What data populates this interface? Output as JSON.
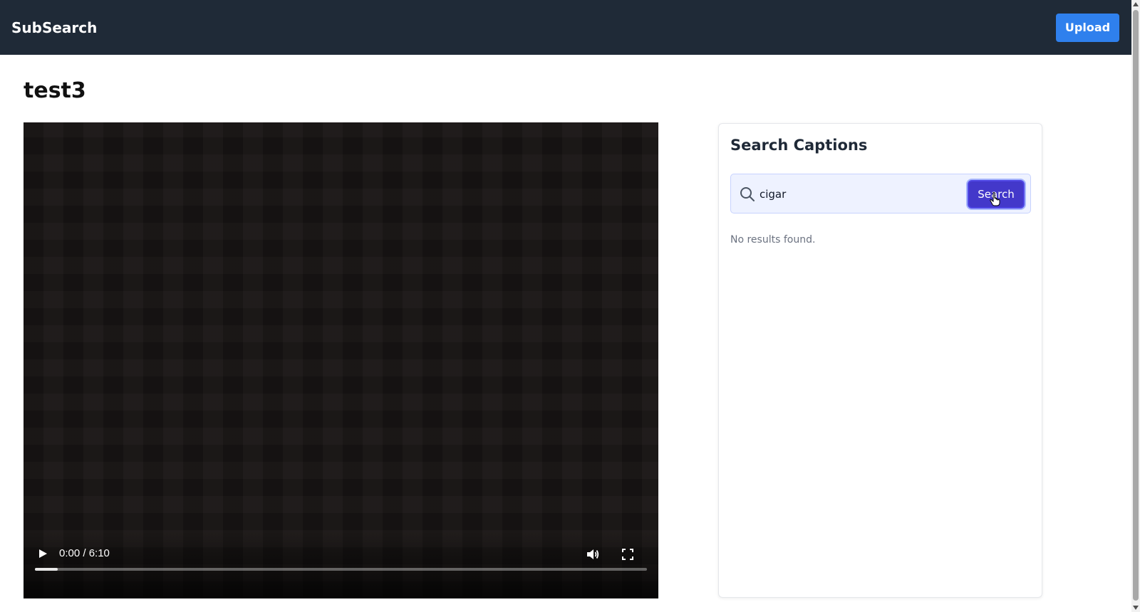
{
  "header": {
    "brand": "SubSearch",
    "upload_label": "Upload"
  },
  "page": {
    "title": "test3"
  },
  "video": {
    "time_display": "0:00 / 6:10",
    "progress_fraction": 0.037,
    "icons": [
      "play-icon",
      "volume-icon",
      "fullscreen-icon",
      "more-options-icon"
    ]
  },
  "search": {
    "panel_title": "Search Captions",
    "query": "cigar",
    "button_label": "Search",
    "empty_message": "No results found."
  },
  "colors": {
    "navbar": "#1f2a37",
    "upload_button": "#2f80ed",
    "search_button": "#4338ca",
    "search_bar_bg": "#eef2ff"
  }
}
